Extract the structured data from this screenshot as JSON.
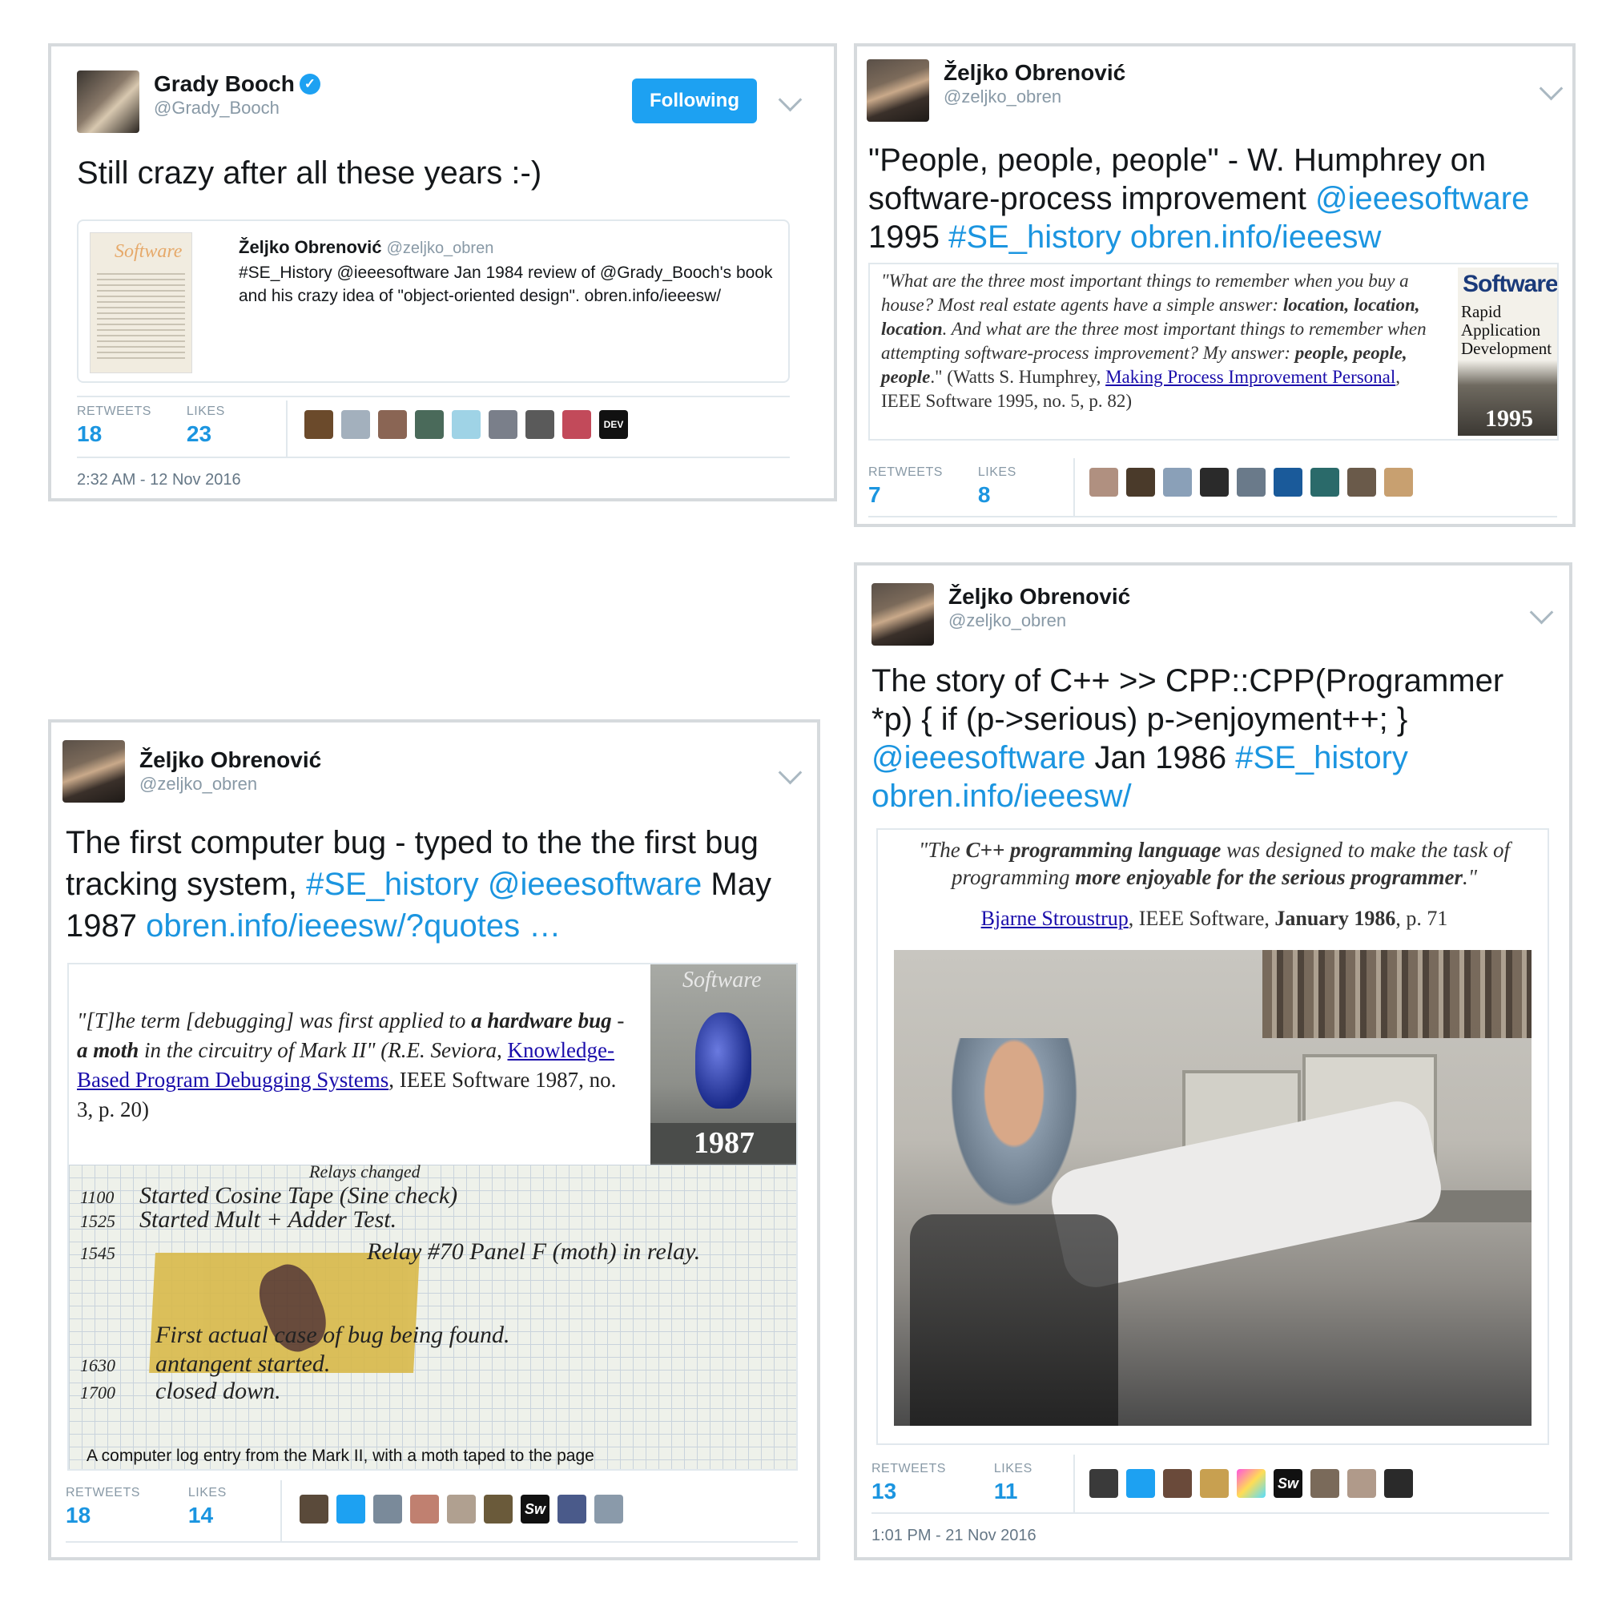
{
  "tweet1": {
    "name": "Grady Booch",
    "handle": "@Grady_Booch",
    "follow_label": "Following",
    "text": "Still crazy after all these years :-)",
    "quote": {
      "name": "Željko Obrenović",
      "handle": "@zeljko_obren",
      "text": "#SE_History @ieeesoftware Jan 1984 review of @Grady_Booch's book and his crazy idea of \"object-oriented design\". obren.info/ieeesw/",
      "thumb_title": "Software"
    },
    "retweets_label": "RETWEETS",
    "retweets": "18",
    "likes_label": "LIKES",
    "likes": "23",
    "timestamp": "2:32 AM - 12 Nov 2016",
    "dev_badge": "DEV"
  },
  "tweet2": {
    "name": "Željko Obrenović",
    "handle": "@zeljko_obren",
    "text_plain": "\"People, people, people\" - W. Humphrey on software-process improvement ",
    "mention": "@ieeesoftware",
    "year": "1995",
    "hashtag": "#SE_history",
    "link": "obren.info/ieeesw",
    "media": {
      "q1": "\"What are the three most important things to remember when you buy a house? Most real estate agents have a simple answer: ",
      "q_bold1": "location, location, location",
      "q2": ". And what are the three most important things to remember when attempting software-process improvement? My answer: ",
      "q_bold2": "people, people, people",
      "q3": ".\" (Watts S. Humphrey, ",
      "q_link": "Making Process Improvement Personal",
      "q4": ", IEEE Software 1995, no. 5, p. 82)",
      "cover_title": "Software",
      "cover_subtitle": "Rapid Application Development",
      "cover_year": "1995"
    },
    "retweets_label": "RETWEETS",
    "retweets": "7",
    "likes_label": "LIKES",
    "likes": "8"
  },
  "tweet3": {
    "name": "Željko Obrenović",
    "handle": "@zeljko_obren",
    "text_plain": "The first computer bug - typed to the the first bug tracking system, ",
    "hashtag": "#SE_history",
    "mention": "@ieeesoftware",
    "date": "May 1987",
    "link": "obren.info/ieeesw/?quotes",
    "ellipsis": "…",
    "media": {
      "q1": "\"[T]he term [debugging] was first applied to ",
      "q_bold1": "a hardware bug",
      "q2": " - ",
      "q_bold2": "a moth",
      "q3": " in the circuitry of Mark II\" (R.E. Seviora, ",
      "q_link": "Knowledge-Based Program Debugging Systems",
      "q4": ", IEEE Software 1987, no. 3, p. 20)",
      "cover_title": "Software",
      "cover_year": "1987",
      "log_lines": [
        {
          "time": "1100",
          "text": "Started Cosine Tape (Sine check)"
        },
        {
          "time": "1525",
          "text": "Started Mult + Adder Test."
        },
        {
          "time": "1545",
          "text": "Relay #70 Panel F (moth) in relay."
        },
        {
          "time": "",
          "text": "First actual case of bug being found."
        },
        {
          "time": "1630",
          "text": "antangent started."
        },
        {
          "time": "1700",
          "text": "closed down."
        }
      ],
      "log_note": "Relays changed",
      "caption": "A computer log entry from the Mark II, with a moth taped to the page"
    },
    "retweets_label": "RETWEETS",
    "retweets": "18",
    "likes_label": "LIKES",
    "likes": "14",
    "sw_badge": "Sw"
  },
  "tweet4": {
    "name": "Željko Obrenović",
    "handle": "@zeljko_obren",
    "text_plain": "The story of C++ >> CPP::CPP(Programmer *p) { if (p->serious) p->enjoyment++; }",
    "mention": "@ieeesoftware",
    "date": "Jan 1986",
    "hashtag": "#SE_history",
    "link": "obren.info/ieeesw/",
    "media": {
      "q1": "\"The ",
      "q_bold1": "C++ programming language",
      "q2": " was designed to make the task of programming ",
      "q_bold2": "more enjoyable for the serious programmer",
      "q3": ".\"",
      "attr_link": "Bjarne Stroustrup",
      "attr1": ", IEEE Software, ",
      "attr_bold": "January 1986",
      "attr2": ", p. 71"
    },
    "retweets_label": "RETWEETS",
    "retweets": "13",
    "likes_label": "LIKES",
    "likes": "11",
    "timestamp": "1:01 PM - 21 Nov 2016",
    "sw_badge": "Sw"
  },
  "colors": {
    "link": "#1b95e0",
    "follow_bg": "#1da1f2",
    "muted": "#8899a6",
    "border": "#d6dadd"
  }
}
